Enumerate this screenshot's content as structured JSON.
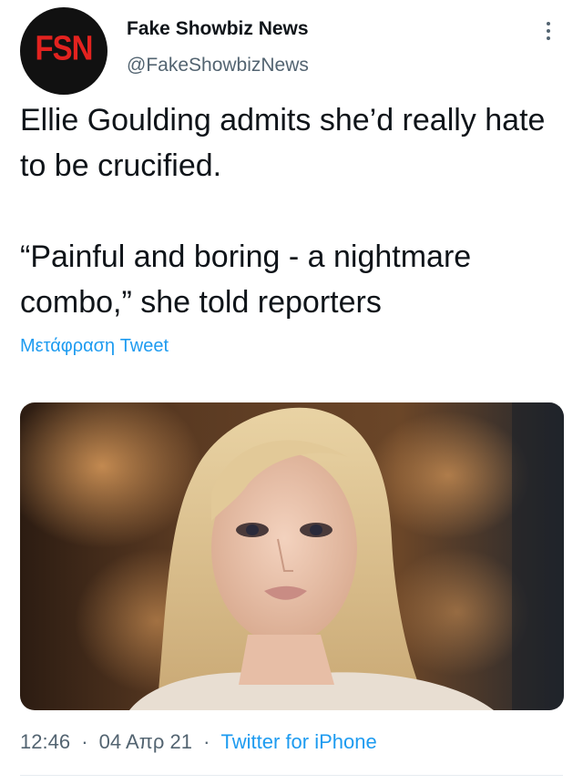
{
  "author": {
    "avatar_text": "FSN",
    "display_name": "Fake Showbiz News",
    "handle": "@FakeShowbizNews"
  },
  "tweet": {
    "text": "Ellie Goulding admits she’d really hate to be crucified.\n\n“Painful and boring - a nightmare combo,” she told reporters",
    "translate_label": "Μετάφραση Tweet"
  },
  "meta": {
    "time": "12:46",
    "separator": "·",
    "date": "04 Απρ 21",
    "source": "Twitter for iPhone"
  },
  "colors": {
    "link": "#1d9bf0",
    "secondary_text": "#536471",
    "avatar_bg": "#111111",
    "avatar_text": "#e3221f"
  },
  "icons": {
    "more": "more-vertical-icon"
  }
}
